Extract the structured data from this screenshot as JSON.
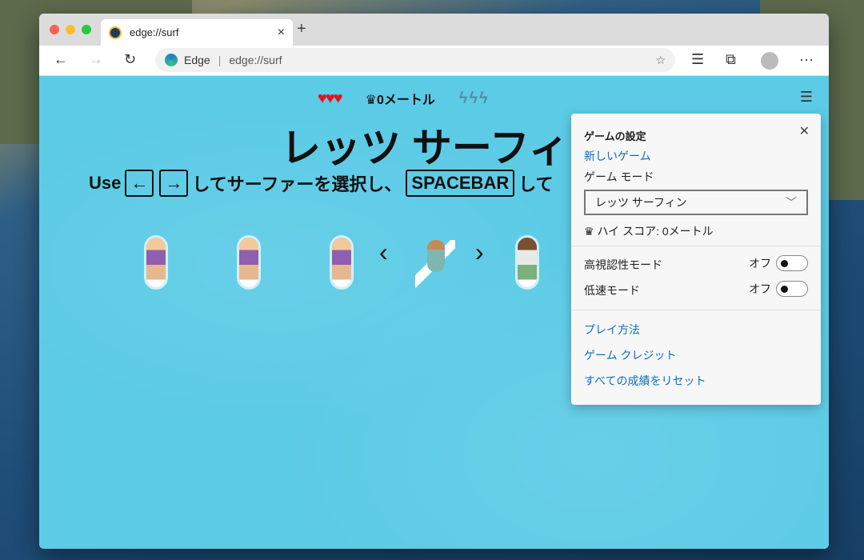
{
  "browser": {
    "tab_title": "edge://surf",
    "address_site": "Edge",
    "address_url": "edge://surf"
  },
  "game": {
    "score": "0メートル",
    "title": "レッツ サーフィン",
    "sub_use": "Use",
    "sub_left_key": "←",
    "sub_right_key": "→",
    "sub_mid": "してサーファーを選択し、",
    "sub_space_key": "SPACEBAR",
    "sub_end": "して"
  },
  "settings": {
    "header": "ゲームの設定",
    "new_game": "新しいゲーム",
    "mode_label": "ゲーム モード",
    "mode_value": "レッツ サーフィン",
    "high_score": "ハイ スコア: 0メートル",
    "high_contrast": "高視認性モード",
    "high_contrast_state": "オフ",
    "slow_mode": "低速モード",
    "slow_mode_state": "オフ",
    "how_to_play": "プレイ方法",
    "credits": "ゲーム クレジット",
    "reset": "すべての成績をリセット"
  }
}
